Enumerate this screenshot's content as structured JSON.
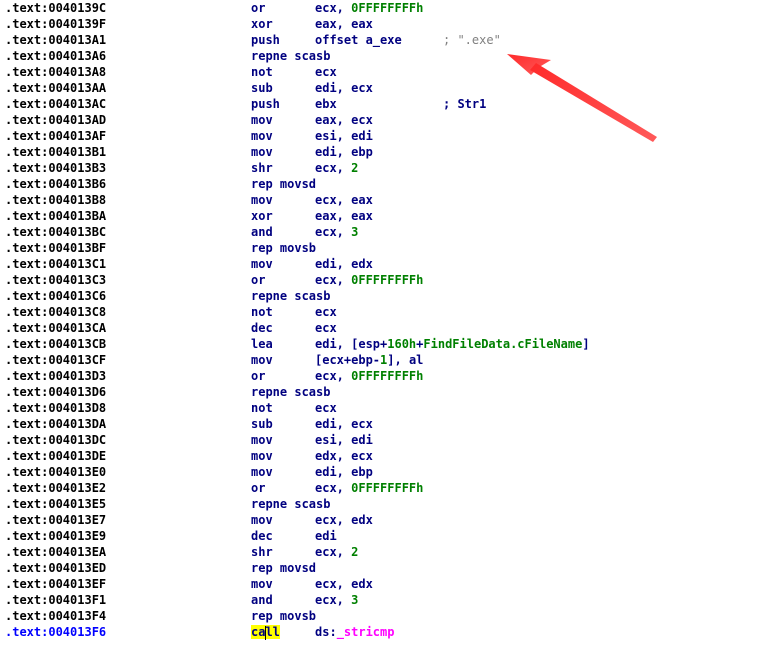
{
  "listing": [
    {
      "seg": ".text:",
      "off": "0040139C",
      "mnem": "or",
      "ops": [
        {
          "t": "ecx, "
        },
        {
          "t": "0FFFFFFFFh",
          "c": "num"
        }
      ]
    },
    {
      "seg": ".text:",
      "off": "0040139F",
      "mnem": "xor",
      "ops": [
        {
          "t": "eax, eax"
        }
      ]
    },
    {
      "seg": ".text:",
      "off": "004013A1",
      "mnem": "push",
      "ops": [
        {
          "t": "offset a_exe"
        }
      ],
      "comment": "; \".exe\""
    },
    {
      "seg": ".text:",
      "off": "004013A6",
      "mnem": "repne scasb",
      "ops": []
    },
    {
      "seg": ".text:",
      "off": "004013A8",
      "mnem": "not",
      "ops": [
        {
          "t": "ecx"
        }
      ]
    },
    {
      "seg": ".text:",
      "off": "004013AA",
      "mnem": "sub",
      "ops": [
        {
          "t": "edi, ecx"
        }
      ]
    },
    {
      "seg": ".text:",
      "off": "004013AC",
      "mnem": "push",
      "ops": [
        {
          "t": "ebx"
        }
      ],
      "comment": "; Str1",
      "comment_named": true
    },
    {
      "seg": ".text:",
      "off": "004013AD",
      "mnem": "mov",
      "ops": [
        {
          "t": "eax, ecx"
        }
      ]
    },
    {
      "seg": ".text:",
      "off": "004013AF",
      "mnem": "mov",
      "ops": [
        {
          "t": "esi, edi"
        }
      ]
    },
    {
      "seg": ".text:",
      "off": "004013B1",
      "mnem": "mov",
      "ops": [
        {
          "t": "edi, ebp"
        }
      ]
    },
    {
      "seg": ".text:",
      "off": "004013B3",
      "mnem": "shr",
      "ops": [
        {
          "t": "ecx, "
        },
        {
          "t": "2",
          "c": "num"
        }
      ]
    },
    {
      "seg": ".text:",
      "off": "004013B6",
      "mnem": "rep movsd",
      "ops": []
    },
    {
      "seg": ".text:",
      "off": "004013B8",
      "mnem": "mov",
      "ops": [
        {
          "t": "ecx, eax"
        }
      ]
    },
    {
      "seg": ".text:",
      "off": "004013BA",
      "mnem": "xor",
      "ops": [
        {
          "t": "eax, eax"
        }
      ]
    },
    {
      "seg": ".text:",
      "off": "004013BC",
      "mnem": "and",
      "ops": [
        {
          "t": "ecx, "
        },
        {
          "t": "3",
          "c": "num"
        }
      ]
    },
    {
      "seg": ".text:",
      "off": "004013BF",
      "mnem": "rep movsb",
      "ops": []
    },
    {
      "seg": ".text:",
      "off": "004013C1",
      "mnem": "mov",
      "ops": [
        {
          "t": "edi, edx"
        }
      ]
    },
    {
      "seg": ".text:",
      "off": "004013C3",
      "mnem": "or",
      "ops": [
        {
          "t": "ecx, "
        },
        {
          "t": "0FFFFFFFFh",
          "c": "num"
        }
      ]
    },
    {
      "seg": ".text:",
      "off": "004013C6",
      "mnem": "repne scasb",
      "ops": []
    },
    {
      "seg": ".text:",
      "off": "004013C8",
      "mnem": "not",
      "ops": [
        {
          "t": "ecx"
        }
      ]
    },
    {
      "seg": ".text:",
      "off": "004013CA",
      "mnem": "dec",
      "ops": [
        {
          "t": "ecx"
        }
      ]
    },
    {
      "seg": ".text:",
      "off": "004013CB",
      "mnem": "lea",
      "ops": [
        {
          "t": "edi, [esp+"
        },
        {
          "t": "160h",
          "c": "num"
        },
        {
          "t": "+"
        },
        {
          "t": "FindFileData.cFileName",
          "c": "sym"
        },
        {
          "t": "]"
        }
      ]
    },
    {
      "seg": ".text:",
      "off": "004013CF",
      "mnem": "mov",
      "ops": [
        {
          "t": "[ecx+ebp-"
        },
        {
          "t": "1",
          "c": "num"
        },
        {
          "t": "], al"
        }
      ]
    },
    {
      "seg": ".text:",
      "off": "004013D3",
      "mnem": "or",
      "ops": [
        {
          "t": "ecx, "
        },
        {
          "t": "0FFFFFFFFh",
          "c": "num"
        }
      ]
    },
    {
      "seg": ".text:",
      "off": "004013D6",
      "mnem": "repne scasb",
      "ops": []
    },
    {
      "seg": ".text:",
      "off": "004013D8",
      "mnem": "not",
      "ops": [
        {
          "t": "ecx"
        }
      ]
    },
    {
      "seg": ".text:",
      "off": "004013DA",
      "mnem": "sub",
      "ops": [
        {
          "t": "edi, ecx"
        }
      ]
    },
    {
      "seg": ".text:",
      "off": "004013DC",
      "mnem": "mov",
      "ops": [
        {
          "t": "esi, edi"
        }
      ]
    },
    {
      "seg": ".text:",
      "off": "004013DE",
      "mnem": "mov",
      "ops": [
        {
          "t": "edx, ecx"
        }
      ]
    },
    {
      "seg": ".text:",
      "off": "004013E0",
      "mnem": "mov",
      "ops": [
        {
          "t": "edi, ebp"
        }
      ]
    },
    {
      "seg": ".text:",
      "off": "004013E2",
      "mnem": "or",
      "ops": [
        {
          "t": "ecx, "
        },
        {
          "t": "0FFFFFFFFh",
          "c": "num"
        }
      ]
    },
    {
      "seg": ".text:",
      "off": "004013E5",
      "mnem": "repne scasb",
      "ops": []
    },
    {
      "seg": ".text:",
      "off": "004013E7",
      "mnem": "mov",
      "ops": [
        {
          "t": "ecx, edx"
        }
      ]
    },
    {
      "seg": ".text:",
      "off": "004013E9",
      "mnem": "dec",
      "ops": [
        {
          "t": "edi"
        }
      ]
    },
    {
      "seg": ".text:",
      "off": "004013EA",
      "mnem": "shr",
      "ops": [
        {
          "t": "ecx, "
        },
        {
          "t": "2",
          "c": "num"
        }
      ]
    },
    {
      "seg": ".text:",
      "off": "004013ED",
      "mnem": "rep movsd",
      "ops": []
    },
    {
      "seg": ".text:",
      "off": "004013EF",
      "mnem": "mov",
      "ops": [
        {
          "t": "ecx, edx"
        }
      ]
    },
    {
      "seg": ".text:",
      "off": "004013F1",
      "mnem": "and",
      "ops": [
        {
          "t": "ecx, "
        },
        {
          "t": "3",
          "c": "num"
        }
      ]
    },
    {
      "seg": ".text:",
      "off": "004013F4",
      "mnem": "rep movsb",
      "ops": []
    },
    {
      "seg": ".text:",
      "off": "004013F6",
      "mnem": "call",
      "ops": [
        {
          "t": "ds:"
        },
        {
          "t": "_stricmp",
          "c": "imp"
        }
      ],
      "current": true,
      "highlight_mnem": true
    }
  ],
  "colors": {
    "address": "#000000",
    "current_address": "#0000ff",
    "code": "#000080",
    "number": "#008000",
    "import": "#ff00ff",
    "comment": "#808080",
    "highlight": "#ffff00",
    "annotation_arrow": "#ff3b3b"
  },
  "annotation": {
    "type": "arrow",
    "points_to_comment_of": "004013A1"
  }
}
